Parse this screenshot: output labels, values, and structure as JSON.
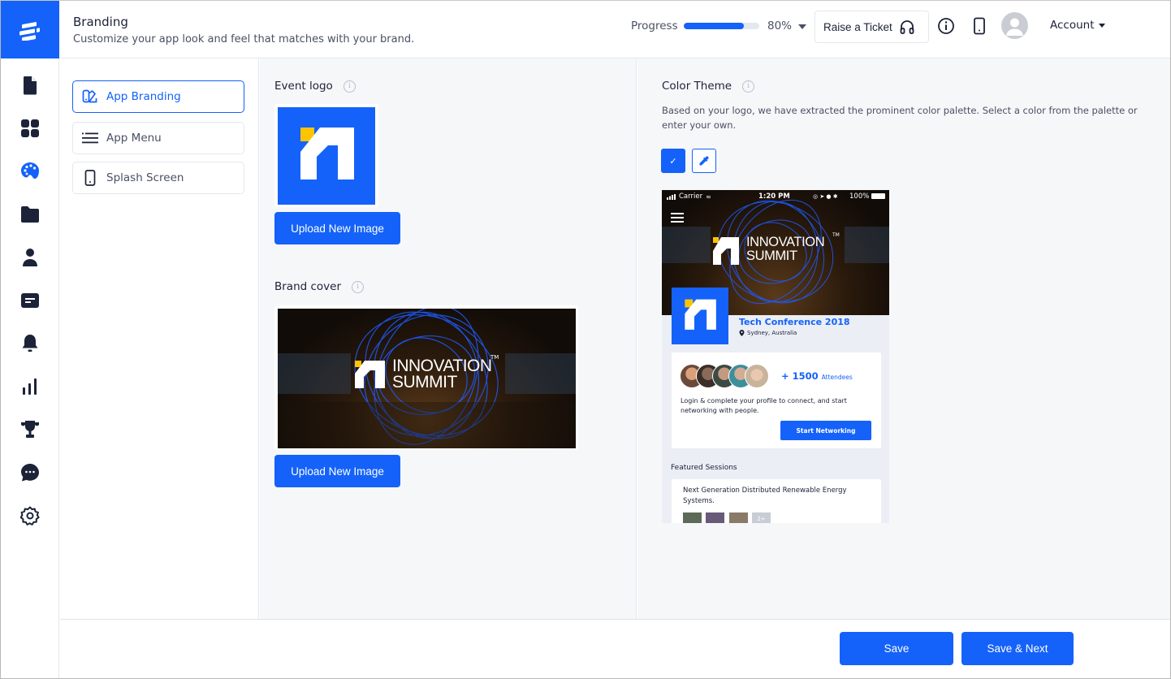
{
  "header": {
    "title": "Branding",
    "subtitle": "Customize your app look and feel that matches with your brand.",
    "progress_label": "Progress",
    "progress_value": 80,
    "progress_text": "80%",
    "ticket_label": "Raise a Ticket",
    "account_label": "Account"
  },
  "rail": {
    "items": [
      {
        "icon": "document-icon"
      },
      {
        "icon": "dashboard-grid-icon"
      },
      {
        "icon": "palette-icon",
        "active": true
      },
      {
        "icon": "folder-icon"
      },
      {
        "icon": "user-icon"
      },
      {
        "icon": "message-card-icon"
      },
      {
        "icon": "bell-icon"
      },
      {
        "icon": "bar-chart-icon"
      },
      {
        "icon": "trophy-icon"
      },
      {
        "icon": "chat-bubble-icon"
      },
      {
        "icon": "settings-gear-icon"
      }
    ]
  },
  "subnav": {
    "items": [
      {
        "label": "App Branding",
        "icon": "branding-icon",
        "active": true
      },
      {
        "label": "App Menu",
        "icon": "menu-lines-icon"
      },
      {
        "label": "Splash Screen",
        "icon": "mobile-phone-icon"
      }
    ]
  },
  "event_logo": {
    "title": "Event logo",
    "upload_label": "Upload New Image"
  },
  "brand_cover": {
    "title": "Brand cover",
    "upload_label": "Upload New Image",
    "cover_text_line1": "INNOVATION",
    "cover_text_line2": "SUMMIT",
    "trademark": "TM"
  },
  "color_theme": {
    "title": "Color Theme",
    "description": "Based on your logo, we have extracted the prominent color palette. Select a color from the palette or enter your own.",
    "selected_color": "#1462f9",
    "swatch_check": "✓"
  },
  "preview": {
    "status_carrier": "Carrier",
    "status_time": "1:20 PM",
    "status_battery": "100%",
    "cover_text_line1": "INNOVATION",
    "cover_text_line2": "SUMMIT",
    "trademark": "TM",
    "event_name": "Tech Conference 2018",
    "event_location": "Sydney, Australia",
    "attendees_count": "+ 1500",
    "attendees_label": "Attendees",
    "networking_message": "Login & complete your profile to connect, and start networking with people.",
    "networking_button": "Start Networking",
    "featured_title": "Featured Sessions",
    "session_title": "Next Generation Distributed Renewable Energy Systems.",
    "session_more": "2+"
  },
  "footer": {
    "save_label": "Save",
    "save_next_label": "Save & Next"
  },
  "colors": {
    "accent": "#1462f9",
    "logo_yellow": "#ffc400",
    "text_dark": "#1c2238"
  }
}
